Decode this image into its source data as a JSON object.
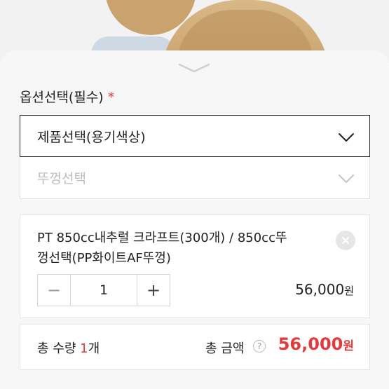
{
  "option": {
    "label": "옵션선택(필수)",
    "required_mark": "*",
    "product_select": "제품선택(용기색상)",
    "lid_select_placeholder": "뚜껑선택"
  },
  "item": {
    "name_line1": "PT 850cc내추럴 크라프트(300개) / 850cc뚜",
    "name_line2": "껑선택(PP화이트AF뚜껑)",
    "minus": "−",
    "quantity": "1",
    "plus": "+",
    "price": "56,000",
    "currency": "원"
  },
  "summary": {
    "qty_label": "총 수량 ",
    "qty_value": "1",
    "qty_unit": "개",
    "amount_label": "총 금액",
    "help": "?",
    "amount": "56,000",
    "currency": "원"
  },
  "icons": {
    "dropdown": "chevron-down-icon",
    "remove": "close-icon",
    "sheet_handle": "chevron-down-icon"
  },
  "colors": {
    "accent": "#e23b3b",
    "sheet_bg": "#f7f7f7"
  }
}
